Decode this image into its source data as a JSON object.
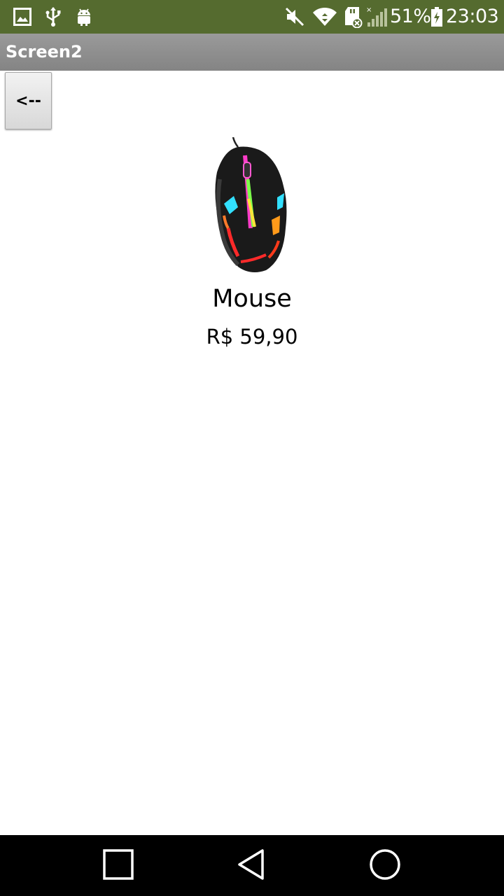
{
  "status_bar": {
    "battery_percent": "51%",
    "time": "23:03",
    "icons": [
      "image-icon",
      "usb-icon",
      "android-icon",
      "mute-icon",
      "wifi-icon",
      "sd-card-icon",
      "signal-icon",
      "battery-charging-icon"
    ],
    "background_color": "#556b2f"
  },
  "title_bar": {
    "title": "Screen2"
  },
  "back_button": {
    "label": "<--"
  },
  "product": {
    "image_icon": "gaming-mouse-image",
    "name": "Mouse",
    "price": "R$ 59,90"
  },
  "nav_bar": {
    "buttons": [
      "recents-button",
      "back-nav-button",
      "home-button"
    ]
  }
}
